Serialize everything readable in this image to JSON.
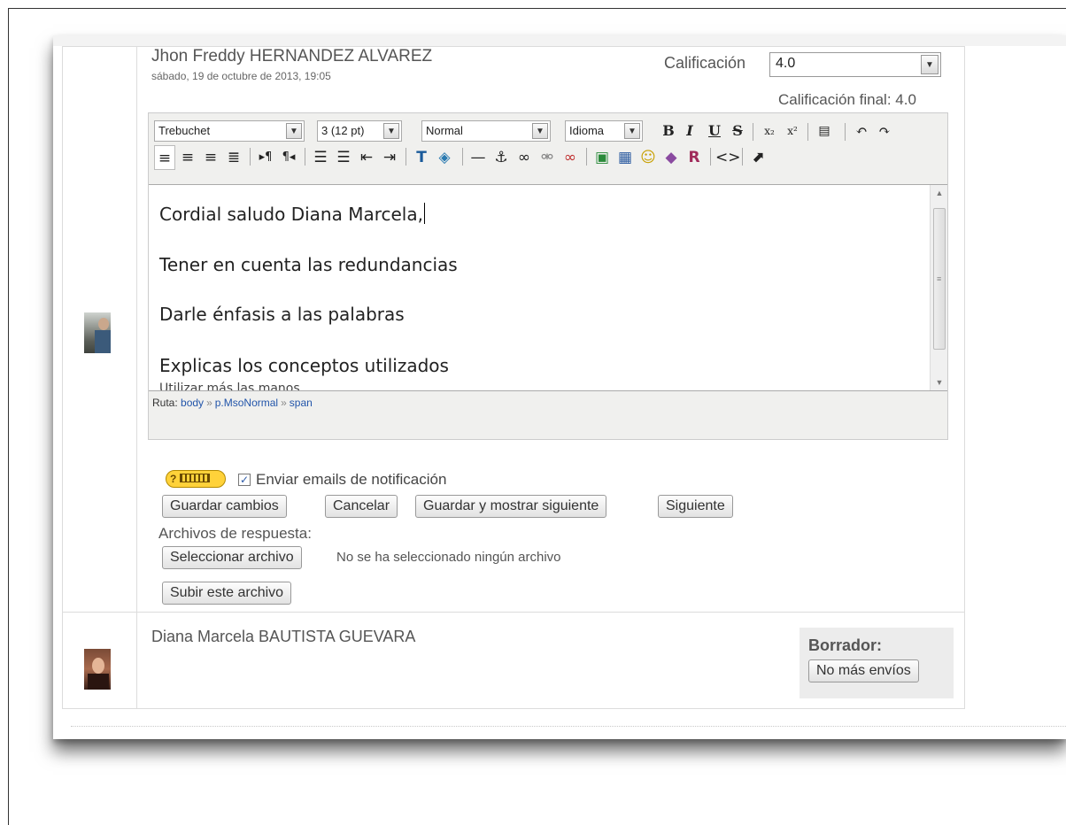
{
  "submission1": {
    "student_name": "Jhon Freddy HERNANDEZ ALVAREZ",
    "date": "sábado, 19 de octubre de 2013, 19:05",
    "grade_label": "Calificación",
    "grade_value": "4.0",
    "final_grade": "Calificación final: 4.0"
  },
  "toolbar": {
    "font_family": "Trebuchet",
    "font_size": "3 (12 pt)",
    "format": "Normal",
    "language": "Idioma",
    "bold": "B",
    "italic": "I",
    "underline": "U",
    "strikethrough": "S"
  },
  "editor": {
    "lines": [
      "Cordial saludo Diana Marcela,",
      "Tener en cuenta las redundancias",
      "Darle énfasis a las palabras",
      "Explicas los conceptos utilizados",
      "Utilizar más las manos"
    ],
    "path_label": "Ruta:",
    "path": [
      "body",
      "p.MsoNormal",
      "span"
    ]
  },
  "notify": {
    "label": "Enviar emails de notificación",
    "checked": true
  },
  "buttons": {
    "save": "Guardar cambios",
    "cancel": "Cancelar",
    "save_next": "Guardar y mostrar siguiente",
    "next": "Siguiente",
    "choose_file": "Seleccionar archivo",
    "upload": "Subir este archivo"
  },
  "response_files": {
    "label": "Archivos de respuesta:",
    "no_file": "No se ha seleccionado ningún archivo"
  },
  "submission2": {
    "student_name": "Diana Marcela BAUTISTA GUEVARA",
    "draft_label": "Borrador:",
    "no_more_button": "No más envíos"
  }
}
